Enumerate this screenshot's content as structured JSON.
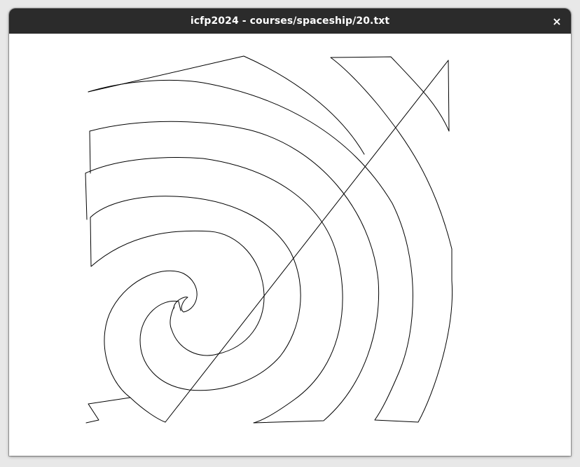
{
  "window": {
    "title": "icfp2024 - courses/spaceship/20.txt",
    "close_icon": "close-icon",
    "close_glyph": "×"
  },
  "drawing": {
    "stroke_color": "#000000",
    "background_color": "#ffffff"
  }
}
